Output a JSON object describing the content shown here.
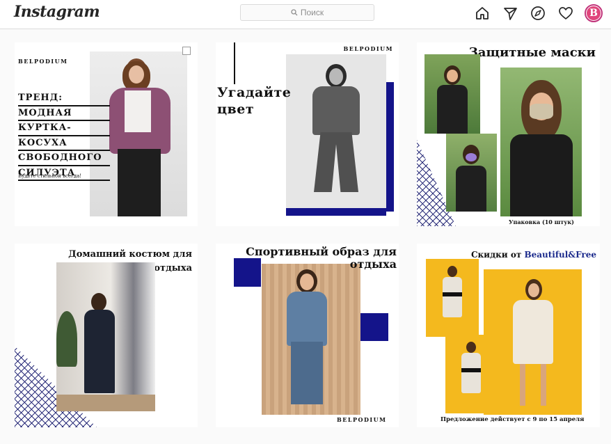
{
  "header": {
    "logo": "Instagram",
    "search_placeholder": "Поиск",
    "avatar_letter": "B"
  },
  "icons": [
    "home-icon",
    "direct-icon",
    "explore-icon",
    "activity-heart-icon",
    "profile-avatar"
  ],
  "colors": {
    "navy": "#14148a",
    "pattern": "#2b2e7a",
    "yellow": "#f4b91e",
    "avatar": "#e0457b"
  },
  "posts": [
    {
      "brand": "BELPODIUM",
      "title_lines": [
        "ТРЕНД:",
        "МОДНАЯ",
        "КУРТКА-",
        "КОСУХА",
        "СВОБОДНОГО",
        "СИЛУЭТА"
      ],
      "subtitle": "Будьте стильной всегда!"
    },
    {
      "brand": "BELPODIUM",
      "title_lines": [
        "Угадайте",
        "цвет"
      ]
    },
    {
      "title": "Защитные маски",
      "caption": "Упаковка (10 штук)"
    },
    {
      "title_lines": [
        "Домашний костюм для",
        "отдыха"
      ]
    },
    {
      "title_lines": [
        "Спортивный образ для",
        "отдыха"
      ],
      "brand": "BELPODIUM"
    },
    {
      "title_prefix": "Скидки от ",
      "title_brand": "Beautiful&Free",
      "caption": "Предложение действует с 9 по 15 апреля"
    }
  ]
}
